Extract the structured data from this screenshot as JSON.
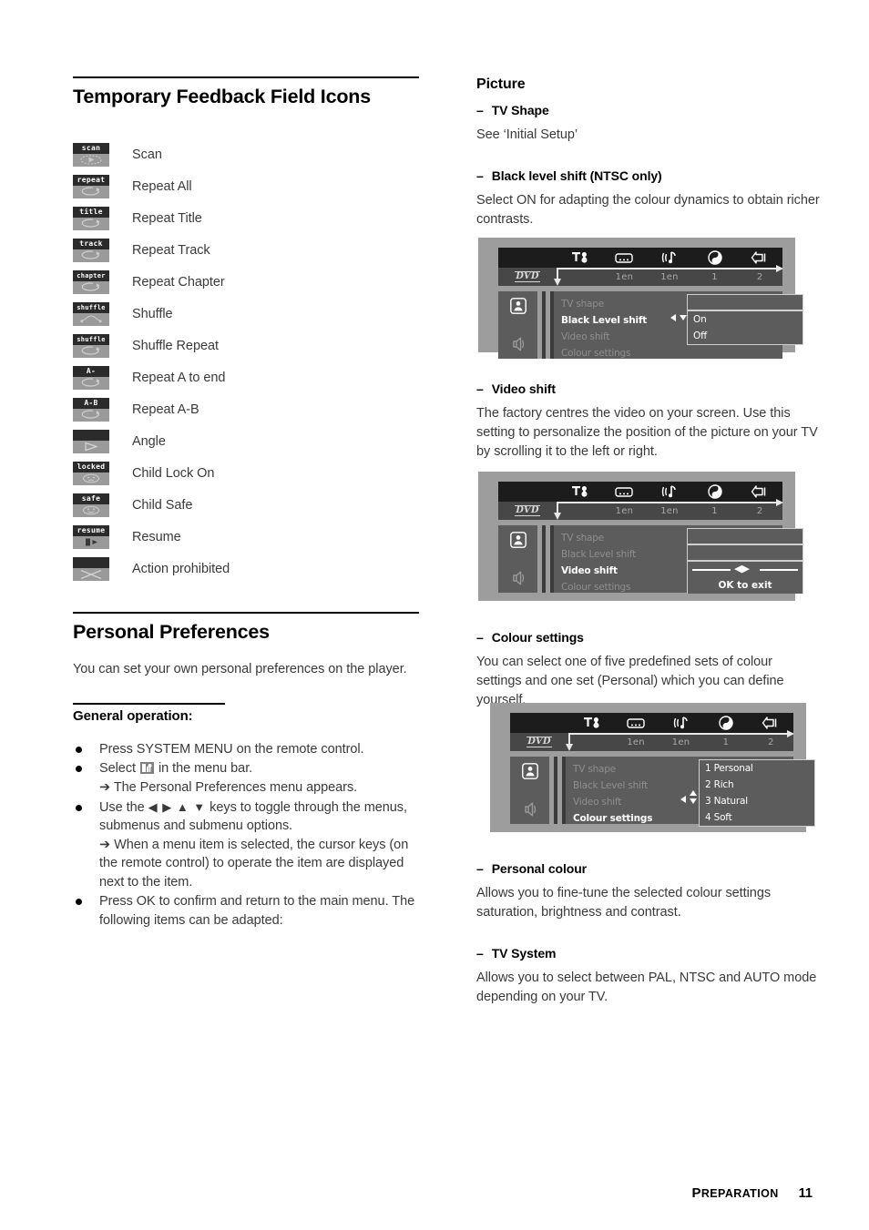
{
  "left_column": {
    "heading": "Temporary Feedback Field Icons",
    "icons": [
      {
        "cap": "scan",
        "glyph": "scan-icon",
        "label": "Scan"
      },
      {
        "cap": "repeat",
        "glyph": "repeat-loop-icon",
        "label": "Repeat All"
      },
      {
        "cap": "title",
        "glyph": "repeat-loop-icon",
        "label": "Repeat Title"
      },
      {
        "cap": "track",
        "glyph": "repeat-loop-icon",
        "label": "Repeat Track"
      },
      {
        "cap": "chapter",
        "glyph": "repeat-loop-icon",
        "label": "Repeat Chapter"
      },
      {
        "cap": "shuffle",
        "glyph": "shuffle-arrows-icon",
        "label": "Shuffle"
      },
      {
        "cap": "shuffle",
        "glyph": "repeat-loop-icon",
        "label": "Shuffle Repeat"
      },
      {
        "cap": "A-",
        "glyph": "repeat-loop-icon",
        "label": "Repeat A to end"
      },
      {
        "cap": "A-B",
        "glyph": "repeat-loop-icon",
        "label": "Repeat A-B"
      },
      {
        "cap": "",
        "glyph": "angle-triangle-icon",
        "label": "Angle"
      },
      {
        "cap": "locked",
        "glyph": "sad-face-icon",
        "label": "Child Lock On"
      },
      {
        "cap": "safe",
        "glyph": "happy-face-icon",
        "label": "Child Safe"
      },
      {
        "cap": "resume",
        "glyph": "resume-play-icon",
        "label": "Resume"
      },
      {
        "cap": "",
        "glyph": "cross-prohibited-icon",
        "label": "Action prohibited"
      }
    ],
    "prefs_heading": "Personal Preferences",
    "prefs_intro": "You can set your own personal preferences on the player.",
    "general_heading": "General operation:",
    "bullets": [
      {
        "text": "Press SYSTEM MENU on the remote control."
      },
      {
        "text_before": "Select ",
        "icon": "preferences-menu-icon",
        "text_after": " in the menu bar.",
        "arrow_line": "➔ The Personal Preferences menu appears."
      },
      {
        "text_before": "Use the ",
        "keys": "◀ ▶  ▲ ▼",
        "text_after": " keys to toggle through the menus, submenus and submenu options.",
        "arrow_line": "➔ When a menu item is selected, the cursor keys (on the remote control) to operate the item are displayed next to the item."
      },
      {
        "text": "Press OK to confirm and return to the main menu. The following items can be adapted:"
      }
    ]
  },
  "right_column": {
    "heading": "Picture",
    "sections": [
      {
        "dash": "–",
        "title": "TV Shape",
        "body": "See ‘Initial Setup’"
      },
      {
        "dash": "–",
        "title": "Black level shift (NTSC only)",
        "body": "Select ON for adapting the colour dynamics to obtain richer contrasts."
      },
      {
        "dash": "–",
        "title": "Video shift",
        "body": "The factory centres the video on your screen. Use this setting to personalize the position of the picture on your TV by scrolling it to the left or right."
      },
      {
        "dash": "–",
        "title": "Colour settings",
        "body": "You can select one of five predefined sets of colour settings and one set (Personal) which you can define yourself."
      },
      {
        "dash": "–",
        "title": "Personal colour",
        "body": "Allows you to fine-tune the selected colour settings saturation, brightness and contrast."
      },
      {
        "dash": "–",
        "title": "TV System",
        "body": "Allows you to select between PAL, NTSC and AUTO mode depending on your TV."
      }
    ]
  },
  "osd_common": {
    "menu_icons": [
      "preferences-tools-icon",
      "subtitle-icon",
      "audio-language-icon",
      "disc-angle-icon",
      "exit-arrow-icon"
    ],
    "disc_label": "DVD",
    "status_values": [
      "1en",
      "1en",
      "1",
      "2"
    ],
    "side_icons": [
      "person-preferences-icon",
      "speaker-sound-icon"
    ],
    "menu_rows": [
      "TV shape",
      "Black Level shift",
      "Video shift",
      "Colour settings"
    ]
  },
  "osd_screens": [
    {
      "name": "black-level-shift-screen",
      "active_row": "Black Level shift",
      "options": [
        "On",
        "Off"
      ]
    },
    {
      "name": "video-shift-screen",
      "active_row": "Video shift",
      "slider_hint": "◀▶",
      "exit_hint": "OK to exit"
    },
    {
      "name": "colour-settings-screen",
      "active_row": "Colour settings",
      "options": [
        "1 Personal",
        "2 Rich",
        "3 Natural",
        "4 Soft"
      ]
    }
  ],
  "footer": {
    "chapter_first": "P",
    "chapter_rest": "REPARATION",
    "page": "11"
  },
  "colors": {
    "text": "#3a3a3c",
    "heading": "#000000",
    "osd_bg": "#9d9d9d",
    "osd_panel": "#5c5c5c",
    "osd_menubar": "#1c1c1c",
    "badge_cap": "#2b2b2b",
    "badge_body": "#9a9a9a"
  }
}
